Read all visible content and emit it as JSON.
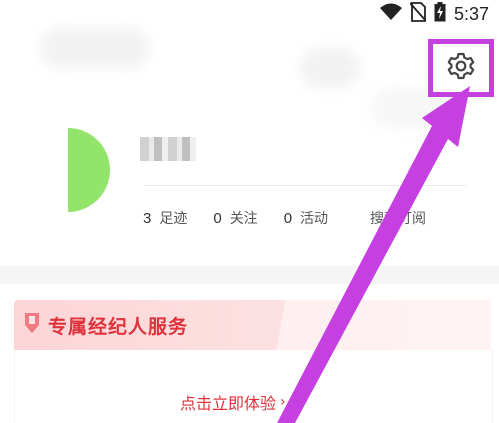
{
  "status_bar": {
    "time": "5:37",
    "icons": [
      "wifi-icon",
      "no-sim-icon",
      "battery-charging-icon"
    ]
  },
  "header": {
    "settings_icon": "gear-icon",
    "avatar_color": "#93e46a"
  },
  "stats": [
    {
      "count": "3",
      "label": "足迹"
    },
    {
      "count": "0",
      "label": "关注"
    },
    {
      "count": "0",
      "label": "活动"
    },
    {
      "count": "",
      "label": "搜索订阅"
    }
  ],
  "agent_card": {
    "title": "专属经纪人服务",
    "cta": "点击立即体验",
    "cta_icon": "chevron-right-icon",
    "accent": "#e0323a"
  },
  "annotation": {
    "color": "#c63fe0"
  }
}
